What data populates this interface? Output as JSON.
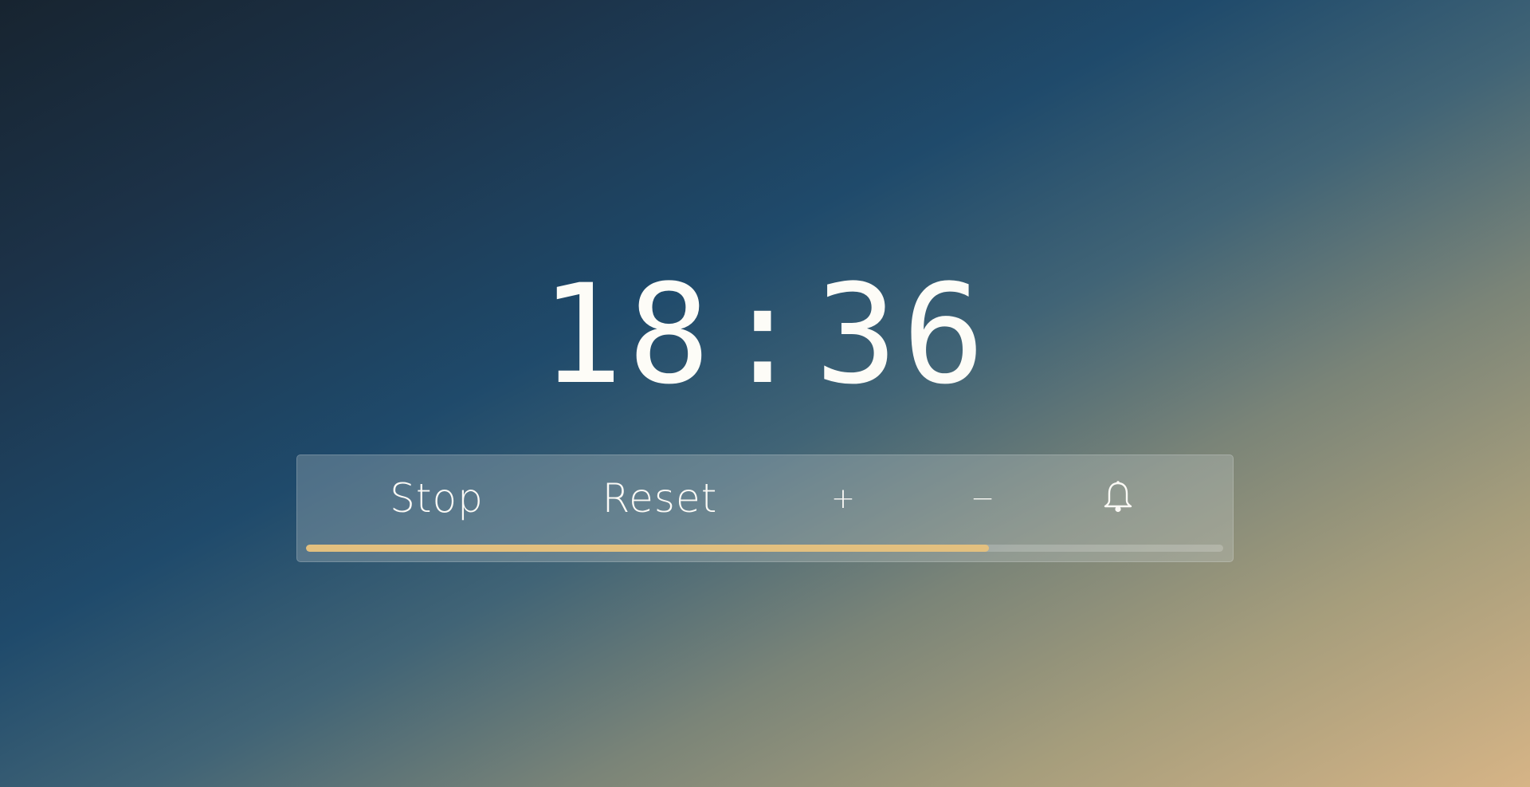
{
  "timer": {
    "minutes": "18",
    "separator": ":",
    "seconds": "36"
  },
  "controls": {
    "stop_label": "Stop",
    "reset_label": "Reset",
    "increase_label": "+",
    "decrease_label": "−",
    "alarm_icon": "bell-icon"
  },
  "progress": {
    "fraction": 0.745,
    "color": "#e3c07f"
  },
  "colors": {
    "text": "#fbfaf6",
    "accent": "#e3c07f"
  }
}
